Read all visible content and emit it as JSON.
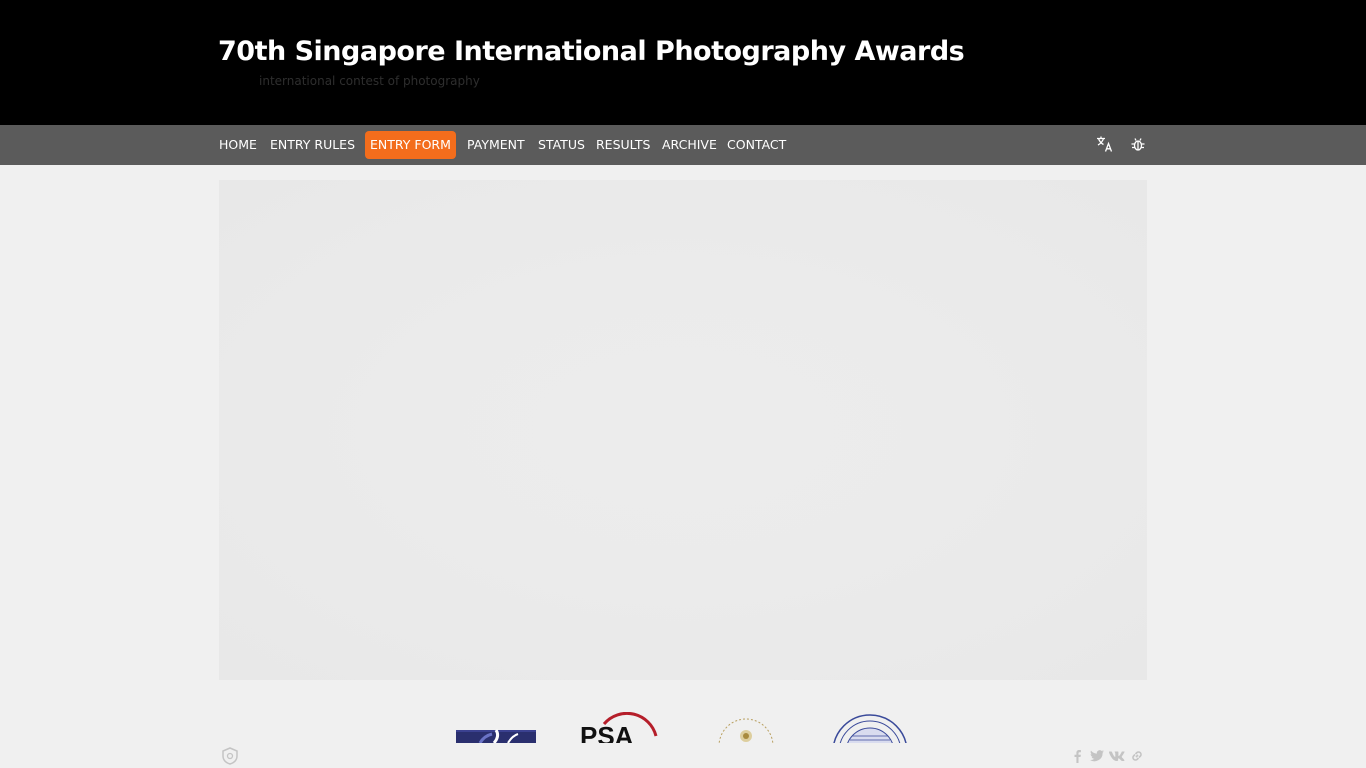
{
  "header": {
    "title": "70th Singapore International Photography Awards",
    "subtitle": "international contest of photography"
  },
  "nav": {
    "items": [
      {
        "label": "HOME",
        "active": false
      },
      {
        "label": "ENTRY RULES",
        "active": false
      },
      {
        "label": "ENTRY FORM",
        "active": true
      },
      {
        "label": "PAYMENT",
        "active": false
      },
      {
        "label": "STATUS",
        "active": false
      },
      {
        "label": "RESULTS",
        "active": false
      },
      {
        "label": "ARCHIVE",
        "active": false
      },
      {
        "label": "CONTACT",
        "active": false
      }
    ],
    "icons": [
      "translate-icon",
      "bug-icon"
    ]
  },
  "logos": {
    "psa_text": "PSA"
  },
  "footer": {
    "social": [
      "facebook-icon",
      "twitter-icon",
      "vk-icon",
      "link-icon"
    ]
  },
  "colors": {
    "header_bg": "#000000",
    "nav_bg": "#5b5b5b",
    "accent": "#f36d1c",
    "page_bg": "#f0f0f0"
  }
}
